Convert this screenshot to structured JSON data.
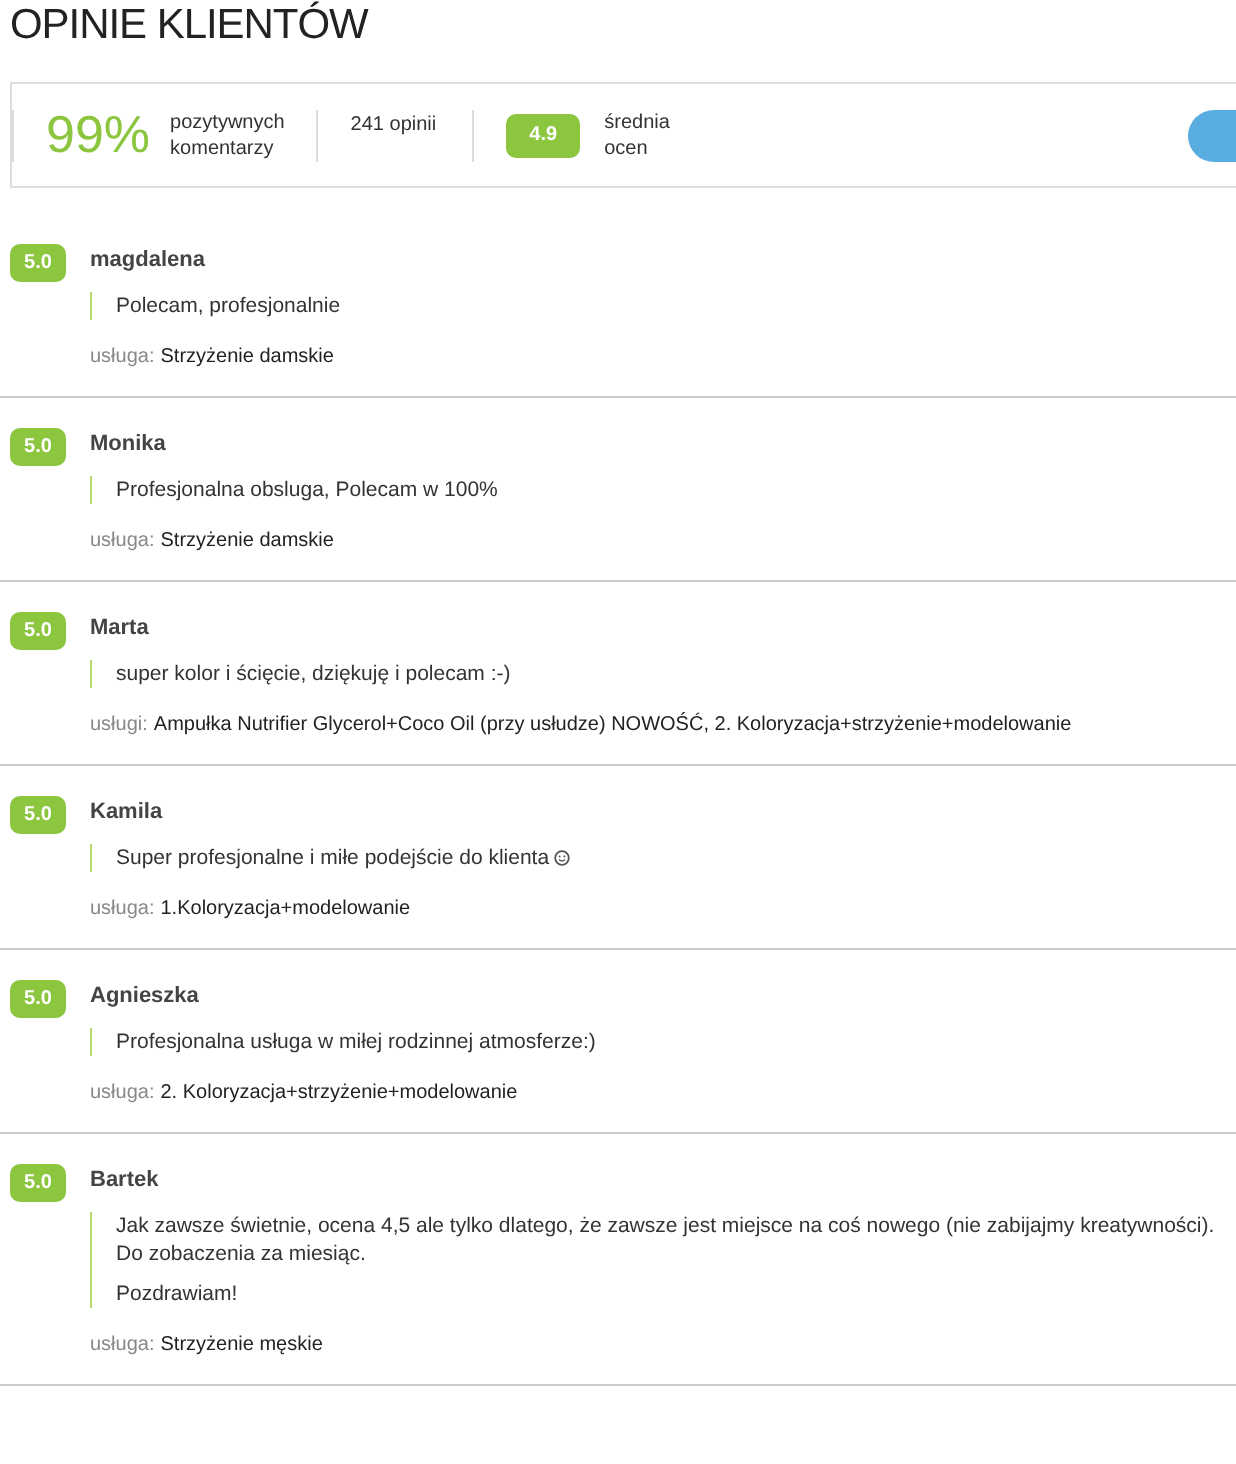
{
  "title": "OPINIE KLIENTÓW",
  "summary": {
    "percent": "99%",
    "percent_label": [
      "pozytywnych",
      "komentarzy"
    ],
    "count": "241 opinii",
    "average": "4.9",
    "average_label": [
      "średnia",
      "ocen"
    ]
  },
  "reviews": [
    {
      "rating": "5.0",
      "author": "magdalena",
      "comment": [
        "Polecam, profesjonalnie"
      ],
      "emoji": false,
      "service_label": "usługa:",
      "service": "Strzyżenie damskie"
    },
    {
      "rating": "5.0",
      "author": "Monika",
      "comment": [
        "Profesjonalna obsluga, Polecam w 100%"
      ],
      "emoji": false,
      "service_label": "usługa:",
      "service": "Strzyżenie damskie"
    },
    {
      "rating": "5.0",
      "author": "Marta",
      "comment": [
        "super kolor i ścięcie, dziękuję i polecam :-)"
      ],
      "emoji": false,
      "service_label": "usługi:",
      "service": "Ampułka Nutrifier Glycerol+Coco Oil (przy usłudze) NOWOŚĆ, 2. Koloryzacja+strzyżenie+modelowanie"
    },
    {
      "rating": "5.0",
      "author": "Kamila",
      "comment": [
        "Super profesjonalne i miłe podejście do klienta"
      ],
      "emoji": true,
      "service_label": "usługa:",
      "service": "1.Koloryzacja+modelowanie"
    },
    {
      "rating": "5.0",
      "author": "Agnieszka",
      "comment": [
        "Profesjonalna usługa w miłej rodzinnej atmosferze:)"
      ],
      "emoji": false,
      "service_label": "usługa:",
      "service": "2. Koloryzacja+strzyżenie+modelowanie"
    },
    {
      "rating": "5.0",
      "author": "Bartek",
      "comment": [
        "Jak zawsze świetnie, ocena 4,5 ale tylko dlatego, że zawsze jest miejsce na coś nowego (nie zabijajmy kreatywności). Do zobaczenia za miesiąc.",
        "Pozdrawiam!"
      ],
      "emoji": false,
      "service_label": "usługa:",
      "service": "Strzyżenie męskie"
    }
  ]
}
